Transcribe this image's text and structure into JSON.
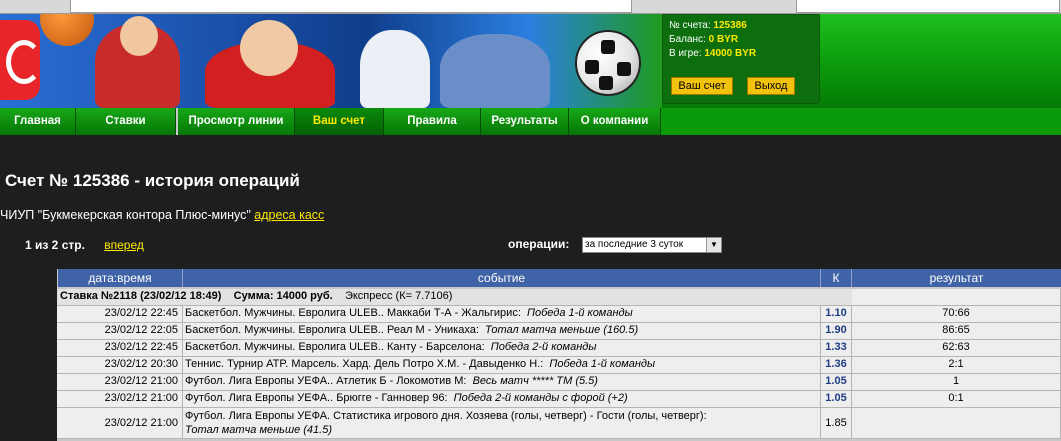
{
  "account": {
    "number_label": "№ счета:",
    "number": "125386",
    "balance_label": "Баланс:",
    "balance": "0 BYR",
    "in_game_label": "В игре:",
    "in_game": "14000 BYR",
    "my_account_button": "Ваш счет",
    "logout_button": "Выход"
  },
  "nav": {
    "items": [
      {
        "label": "Главная"
      },
      {
        "label": "Ставки"
      },
      {
        "label": "Просмотр линии"
      },
      {
        "label": "Ваш счет"
      },
      {
        "label": "Правила"
      },
      {
        "label": "Результаты"
      },
      {
        "label": "О компании"
      }
    ]
  },
  "page": {
    "title": "Счет № 125386 - история операций",
    "company": "ЧИУП \"Букмекерская контора Плюс-минус\"",
    "company_link": "адреса касс",
    "pager": "1 из 2 стр.",
    "next_link": "вперед",
    "ops_label": "операции:",
    "ops_selected": "за последние 3 суток"
  },
  "table": {
    "headers": [
      "дата:время",
      "событие",
      "К",
      "результат"
    ],
    "bet": {
      "title": "Ставка №2118 (23/02/12 18:49)",
      "sum": "Сумма: 14000 руб.",
      "type": "Экспресс (К= 7.7106)"
    },
    "rows": [
      {
        "dt": "23/02/12 22:45",
        "event": "Баскетбол. Мужчины. Евролига ULEB.. Маккаби Т-А - Жальгирис:",
        "bet": "Победа 1-й команды",
        "k": "1.10",
        "result": "70:66"
      },
      {
        "dt": "23/02/12 22:05",
        "event": "Баскетбол. Мужчины. Евролига ULEB.. Реал М - Уникаха:",
        "bet": "Тотал матча меньше (160.5)",
        "k": "1.90",
        "result": "86:65"
      },
      {
        "dt": "23/02/12 22:45",
        "event": "Баскетбол. Мужчины. Евролига ULEB.. Канту - Барселона:",
        "bet": "Победа 2-й команды",
        "k": "1.33",
        "result": "62:63"
      },
      {
        "dt": "23/02/12 20:30",
        "event": "Теннис. Турнир ATP. Марсель. Хард. Дель Потро Х.М. - Давыденко Н.:",
        "bet": "Победа 1-й команды",
        "k": "1.36",
        "result": "2:1"
      },
      {
        "dt": "23/02/12 21:00",
        "event": "Футбол. Лига Европы УЕФА.. Атлетик Б - Локомотив М:",
        "bet": "Весь матч ***** ТМ (5.5)",
        "k": "1.05",
        "result": "1"
      },
      {
        "dt": "23/02/12 21:00",
        "event": "Футбол. Лига Европы УЕФА.. Брюгге - Ганновер 96:",
        "bet": "Победа 2-й команды с форой (+2)",
        "k": "1.05",
        "result": "0:1"
      },
      {
        "dt": "23/02/12 21:00",
        "event": "Футбол. Лига Европы УЕФА. Статистика игрового дня. Хозяева (голы, четверг) - Гости (голы, четверг):",
        "bet": "Тотал матча меньше (41.5)",
        "k": "1.85",
        "result": ""
      }
    ]
  }
}
